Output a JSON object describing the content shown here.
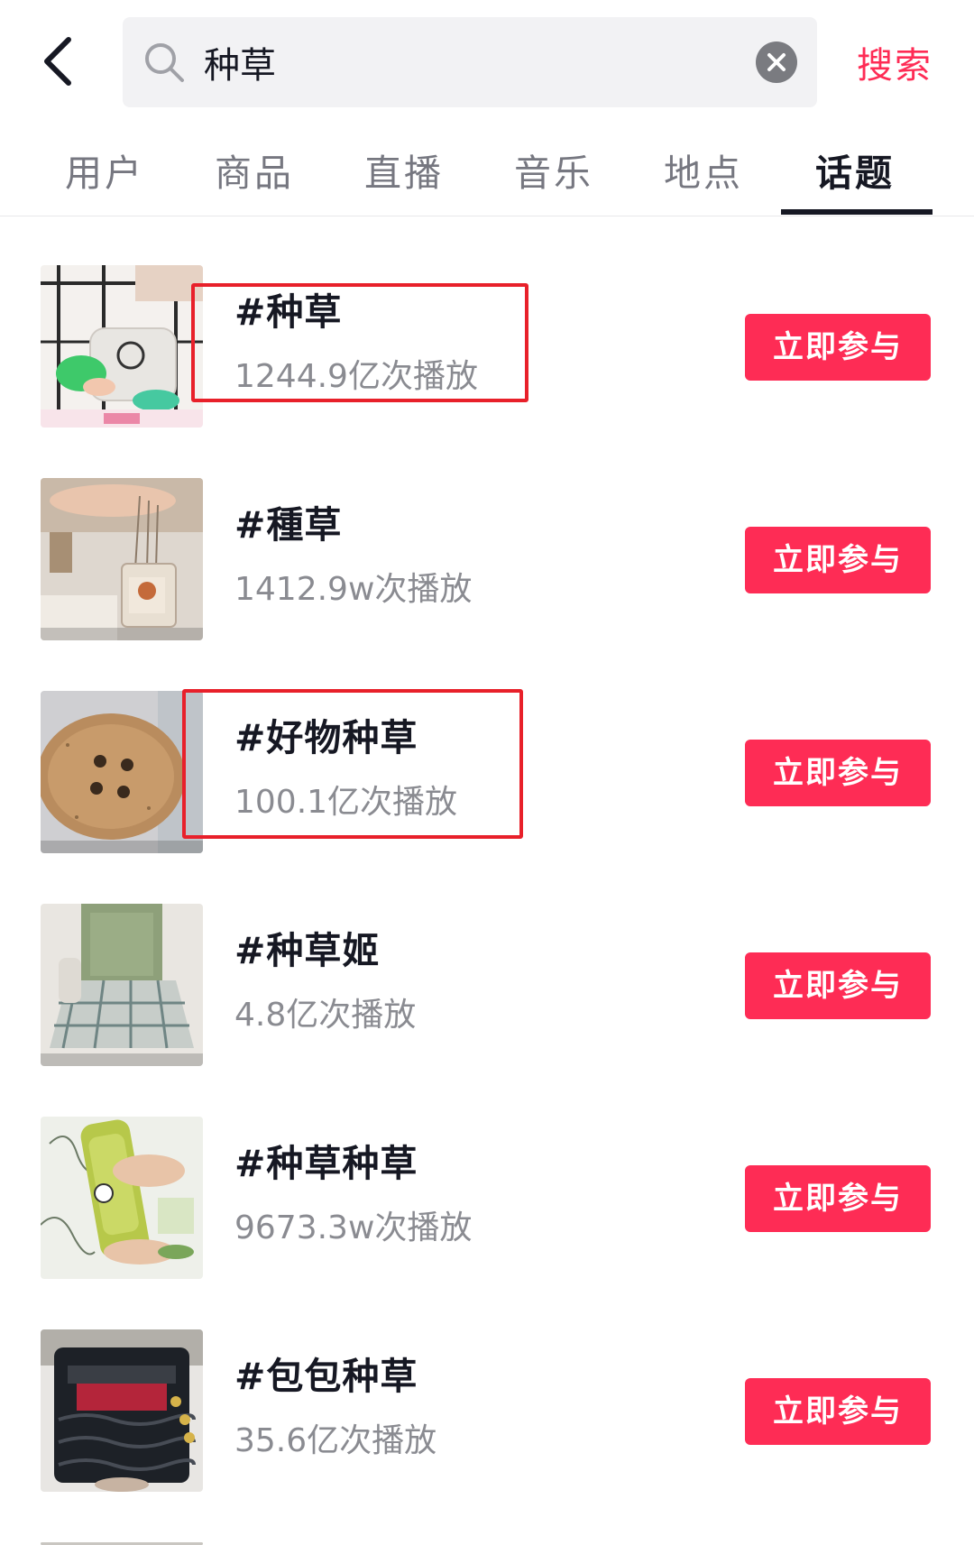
{
  "search": {
    "query": "种草",
    "submit_label": "搜索"
  },
  "tabs": [
    {
      "label": "用户",
      "active": false
    },
    {
      "label": "商品",
      "active": false
    },
    {
      "label": "直播",
      "active": false
    },
    {
      "label": "音乐",
      "active": false
    },
    {
      "label": "地点",
      "active": false
    },
    {
      "label": "话题",
      "active": true
    }
  ],
  "topics": [
    {
      "title": "#种草",
      "views": "1244.9亿次播放",
      "button_label": "立即参与",
      "highlighted": true
    },
    {
      "title": "#種草",
      "views": "1412.9w次播放",
      "button_label": "立即参与",
      "highlighted": false
    },
    {
      "title": "#好物种草",
      "views": "100.1亿次播放",
      "button_label": "立即参与",
      "highlighted": true
    },
    {
      "title": "#种草姬",
      "views": "4.8亿次播放",
      "button_label": "立即参与",
      "highlighted": false
    },
    {
      "title": "#种草种草",
      "views": "9673.3w次播放",
      "button_label": "立即参与",
      "highlighted": false
    },
    {
      "title": "#包包种草",
      "views": "35.6亿次播放",
      "button_label": "立即参与",
      "highlighted": false
    }
  ],
  "colors": {
    "accent": "#fe2c55",
    "highlight": "#e8202a",
    "text_primary": "#161823",
    "text_secondary": "#8a8b91"
  },
  "icons": [
    "back-arrow-icon",
    "search-icon",
    "clear-icon"
  ]
}
